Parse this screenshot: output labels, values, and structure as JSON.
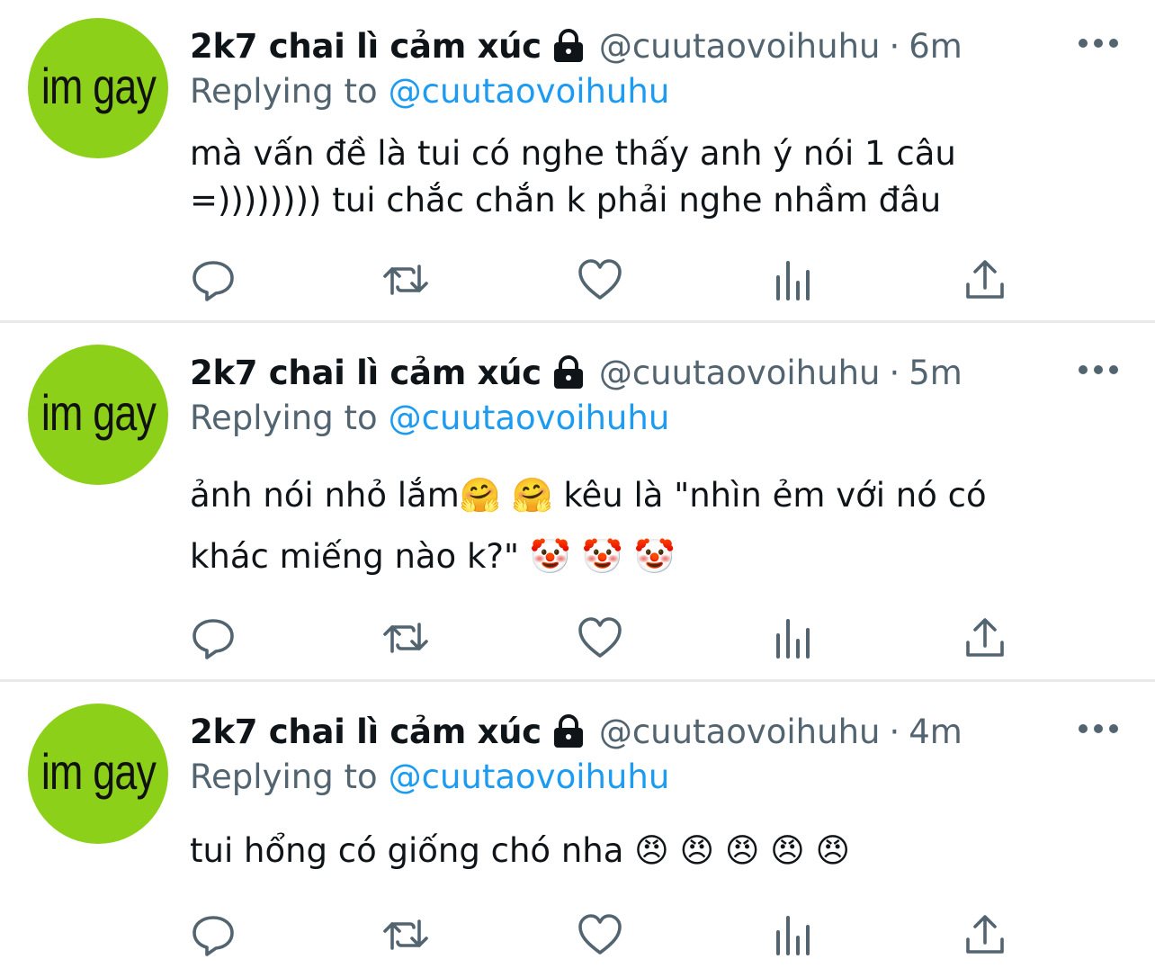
{
  "tweets": [
    {
      "avatar_text": "im gay",
      "display_name": "2k7 chai lì cảm xúc",
      "handle": "@cuutaovoihuhu",
      "separator": "·",
      "time": "6m",
      "replying_label": "Replying to",
      "replying_handle": "@cuutaovoihuhu",
      "text": "mà vấn đề là tui có nghe thấy anh ý nói 1 câu\n=)))))))) tui chắc chắn k phải nghe nhầm đâu"
    },
    {
      "avatar_text": "im gay",
      "display_name": "2k7 chai lì cảm xúc",
      "handle": "@cuutaovoihuhu",
      "separator": "·",
      "time": "5m",
      "replying_label": "Replying to",
      "replying_handle": "@cuutaovoihuhu",
      "text": "ảnh nói nhỏ lắm🤗 🤗  kêu là \"nhìn ẻm với nó có\nkhác miếng nào k?\" 🤡 🤡 🤡"
    },
    {
      "avatar_text": "im gay",
      "display_name": "2k7 chai lì cảm xúc",
      "handle": "@cuutaovoihuhu",
      "separator": "·",
      "time": "4m",
      "replying_label": "Replying to",
      "replying_handle": "@cuutaovoihuhu",
      "text": "tui hổng có giống chó nha 😠 😠 😠 😠 😠"
    }
  ],
  "icons": {
    "lock": "lock-icon",
    "more": "more-icon",
    "reply": "reply-icon",
    "retweet": "retweet-icon",
    "like": "like-icon",
    "views": "views-icon",
    "share": "share-icon"
  },
  "colors": {
    "accent": "#1d9bf0",
    "muted": "#536471",
    "text": "#0f1419",
    "avatar_bg": "#8cd01a",
    "separator": "#e7e9ea"
  }
}
